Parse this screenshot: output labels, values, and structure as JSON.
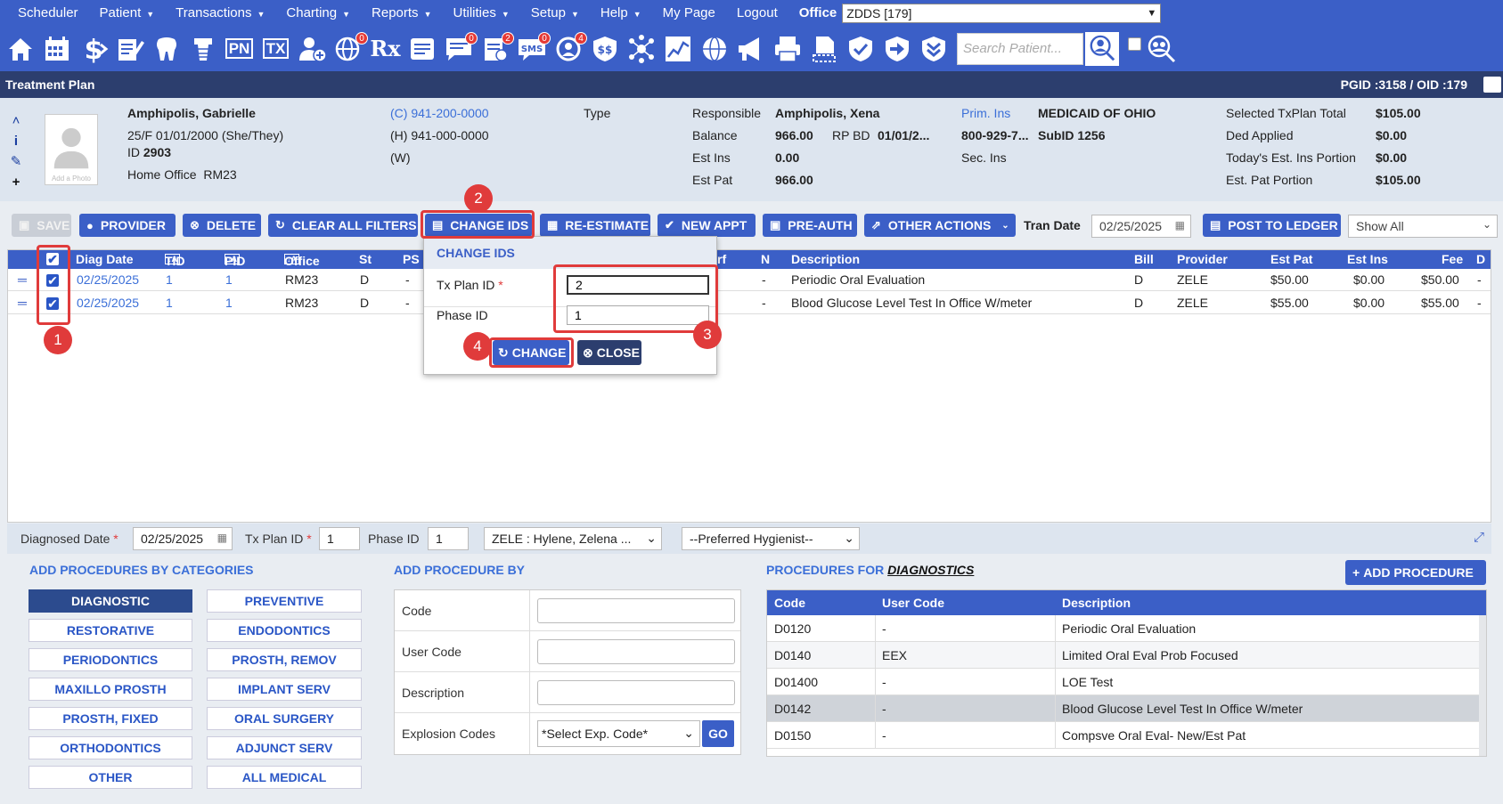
{
  "menu": {
    "items": [
      {
        "label": "Scheduler",
        "caret": false
      },
      {
        "label": "Patient",
        "caret": true
      },
      {
        "label": "Transactions",
        "caret": true
      },
      {
        "label": "Charting",
        "caret": true
      },
      {
        "label": "Reports",
        "caret": true
      },
      {
        "label": "Utilities",
        "caret": true
      },
      {
        "label": "Setup",
        "caret": true
      },
      {
        "label": "Help",
        "caret": true
      },
      {
        "label": "My Page",
        "caret": false
      },
      {
        "label": "Logout",
        "caret": false
      }
    ],
    "office_label": "Office",
    "office_value": "ZDDS [179]"
  },
  "toolbar": {
    "icons": [
      "home-icon",
      "calendar-icon",
      "dollar-icon",
      "notes-icon",
      "tooth-icon",
      "implant-icon",
      "pn-icon",
      "tx-icon",
      "add-user-icon",
      "globe-icon",
      "rx-icon",
      "document-icon",
      "message-icon",
      "clipboard-icon",
      "sms-icon",
      "recall-icon",
      "insurance-icon",
      "network-icon",
      "chart-icon",
      "web-icon",
      "megaphone-icon",
      "print-icon",
      "copy-icon",
      "shield-check-icon",
      "shield-arrow-icon",
      "shield-down-icon"
    ],
    "badges": {
      "globe": "0",
      "message": "0",
      "clipboard": "2",
      "sms": "0",
      "recall": "4"
    },
    "rx_label": "Rx",
    "pn_label": "PN",
    "tx_label": "TX",
    "sms_label": "SMS",
    "search_placeholder": "Search Patient..."
  },
  "titlebar": {
    "title": "Treatment Plan",
    "ids": "PGID :3158  /  OID :179"
  },
  "patient": {
    "name": "Amphipolis, Gabrielle",
    "demo": "25/F  01/01/2000  (She/They)",
    "id_label": "ID",
    "id_value": "2903",
    "home_office_label": "Home Office",
    "home_office_value": "RM23",
    "photo_label": "Add a Photo",
    "phone_c": "(C) 941-200-0000",
    "phone_h": "(H) 941-000-0000",
    "phone_w": "(W)",
    "type_label": "Type",
    "responsible_label": "Responsible",
    "responsible_value": "Amphipolis, Xena",
    "balance_label": "Balance",
    "balance_value": "966.00",
    "rp_bd_label": "RP BD",
    "rp_bd_value": "01/01/2...",
    "est_ins_label": "Est Ins",
    "est_ins_value": "0.00",
    "est_pat_label": "Est Pat",
    "est_pat_value": "966.00",
    "prim_ins_label": "Prim. Ins",
    "prim_ins_value": "MEDICAID OF OHIO",
    "prim_phone": "800-929-7...",
    "subid_label": "SubID",
    "subid_value": "1256",
    "sec_ins_label": "Sec. Ins",
    "sel_total_label": "Selected TxPlan Total",
    "sel_total_value": "$105.00",
    "ded_label": "Ded Applied",
    "ded_value": "$0.00",
    "today_ins_label": "Today's Est. Ins Portion",
    "today_ins_value": "$0.00",
    "est_pat_portion_label": "Est. Pat Portion",
    "est_pat_portion_value": "$105.00"
  },
  "actions": {
    "save": "SAVE",
    "provider": "PROVIDER",
    "delete": "DELETE",
    "clear": "CLEAR ALL FILTERS",
    "change_ids": "CHANGE IDS",
    "reestimate": "RE-ESTIMATE",
    "new_appt": "NEW APPT",
    "preauth": "PRE-AUTH",
    "other": "OTHER ACTIONS",
    "tran_date_label": "Tran Date",
    "tran_date_value": "02/25/2025",
    "post": "POST TO LEDGER",
    "show_all": "Show All"
  },
  "grid": {
    "headers": {
      "diag_date": "Diag Date",
      "tid": "TID",
      "pid": "PID",
      "office": "Office",
      "st": "St",
      "ps": "PS",
      "surf": "rf",
      "n": "N",
      "desc": "Description",
      "bill": "Bill",
      "provider": "Provider",
      "est_pat": "Est Pat",
      "est_ins": "Est Ins",
      "fee": "Fee",
      "d": "D"
    },
    "rows": [
      {
        "date": "02/25/2025",
        "tid": "1",
        "pid": "1",
        "office": "RM23",
        "st": "D",
        "ps": "-",
        "n": "-",
        "desc": "Periodic Oral Evaluation",
        "bill": "D",
        "provider": "ZELE",
        "est_pat": "$50.00",
        "est_ins": "$0.00",
        "fee": "$50.00",
        "d": "-"
      },
      {
        "date": "02/25/2025",
        "tid": "1",
        "pid": "1",
        "office": "RM23",
        "st": "D",
        "ps": "-",
        "n": "-",
        "desc": "Blood Glucose Level Test In Office W/meter",
        "bill": "D",
        "provider": "ZELE",
        "est_pat": "$55.00",
        "est_ins": "$0.00",
        "fee": "$55.00",
        "d": "-"
      }
    ]
  },
  "popup": {
    "title": "CHANGE IDS",
    "txplan_label": "Tx Plan ID",
    "txplan_value": "2",
    "phase_label": "Phase ID",
    "phase_value": "1",
    "change": "CHANGE",
    "close": "CLOSE"
  },
  "callouts": [
    "1",
    "2",
    "3",
    "4"
  ],
  "bottom": {
    "diag_date_label": "Diagnosed Date",
    "diag_date_value": "02/25/2025",
    "txplan_label": "Tx Plan ID",
    "txplan_value": "1",
    "phase_label": "Phase ID",
    "phase_value": "1",
    "provider_value": "ZELE : Hylene, Zelena ...",
    "hygienist_value": "--Preferred Hygienist--"
  },
  "categories": {
    "title": "ADD PROCEDURES BY CATEGORIES",
    "items": [
      "DIAGNOSTIC",
      "PREVENTIVE",
      "RESTORATIVE",
      "ENDODONTICS",
      "PERIODONTICS",
      "PROSTH, REMOV",
      "MAXILLO PROSTH",
      "IMPLANT SERV",
      "PROSTH, FIXED",
      "ORAL SURGERY",
      "ORTHODONTICS",
      "ADJUNCT SERV",
      "OTHER",
      "ALL MEDICAL"
    ]
  },
  "addby": {
    "title": "ADD PROCEDURE BY",
    "code": "Code",
    "user_code": "User Code",
    "description": "Description",
    "explosion": "Explosion Codes",
    "select": "*Select Exp. Code*",
    "go": "GO"
  },
  "procedures": {
    "title_prefix": "PROCEDURES FOR",
    "title_cat": "DIAGNOSTICS",
    "add": "ADD PROCEDURE",
    "headers": {
      "code": "Code",
      "user_code": "User Code",
      "description": "Description"
    },
    "rows": [
      {
        "code": "D0120",
        "user": "-",
        "desc": "Periodic Oral Evaluation"
      },
      {
        "code": "D0140",
        "user": "EEX",
        "desc": "Limited Oral Eval Prob Focused"
      },
      {
        "code": "D01400",
        "user": "-",
        "desc": "LOE Test"
      },
      {
        "code": "D0142",
        "user": "-",
        "desc": "Blood Glucose Level Test In Office W/meter"
      },
      {
        "code": "D0150",
        "user": "-",
        "desc": "Compsve Oral Eval- New/Est Pat"
      }
    ]
  }
}
